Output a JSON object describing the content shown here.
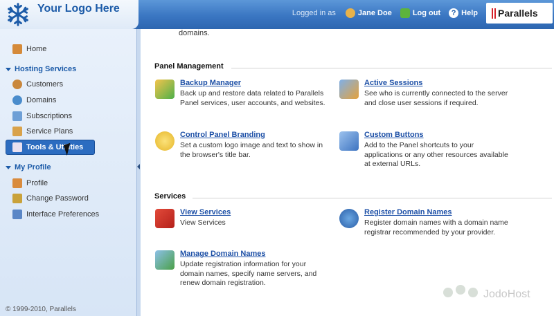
{
  "header": {
    "logo_text": "Your Logo Here",
    "logged_in_as": "Logged in as",
    "user_name": "Jane Doe",
    "logout_label": "Log out",
    "help_label": "Help",
    "brand": "Parallels"
  },
  "sidebar": {
    "home": "Home",
    "hosting_section": "Hosting Services",
    "customers": "Customers",
    "domains": "Domains",
    "subscriptions": "Subscriptions",
    "service_plans": "Service Plans",
    "tools": "Tools & Utilities",
    "profile_section": "My Profile",
    "profile": "Profile",
    "change_password": "Change Password",
    "interface_prefs": "Interface Preferences",
    "copyright": "© 1999-2010, Parallels"
  },
  "content": {
    "top_line": "domains.",
    "panel_management": {
      "title": "Panel Management",
      "items": [
        {
          "title": "Backup Manager",
          "desc": "Back up and restore data related to Parallels Panel services, user accounts, and websites."
        },
        {
          "title": "Active Sessions",
          "desc": "See who is currently connected to the server and close user sessions if required."
        },
        {
          "title": "Control Panel Branding",
          "desc": "Set a custom logo image and text to show in the browser's title bar."
        },
        {
          "title": "Custom Buttons",
          "desc": "Add to the Panel shortcuts to your applications or any other resources available at external URLs."
        }
      ]
    },
    "services": {
      "title": "Services",
      "items": [
        {
          "title": "View Services",
          "desc": "View Services"
        },
        {
          "title": "Register Domain Names",
          "desc": "Register domain names with a domain name registrar recommended by your provider."
        },
        {
          "title": "Manage Domain Names",
          "desc": "Update registration information for your domain names, specify name servers, and renew domain registration."
        }
      ]
    }
  },
  "watermark": "JodoHost",
  "colors": {
    "header_blue": "#3a76c2",
    "link_blue": "#1c4fa6",
    "active_nav": "#2c6cc0",
    "brand_red": "#d5202a"
  }
}
